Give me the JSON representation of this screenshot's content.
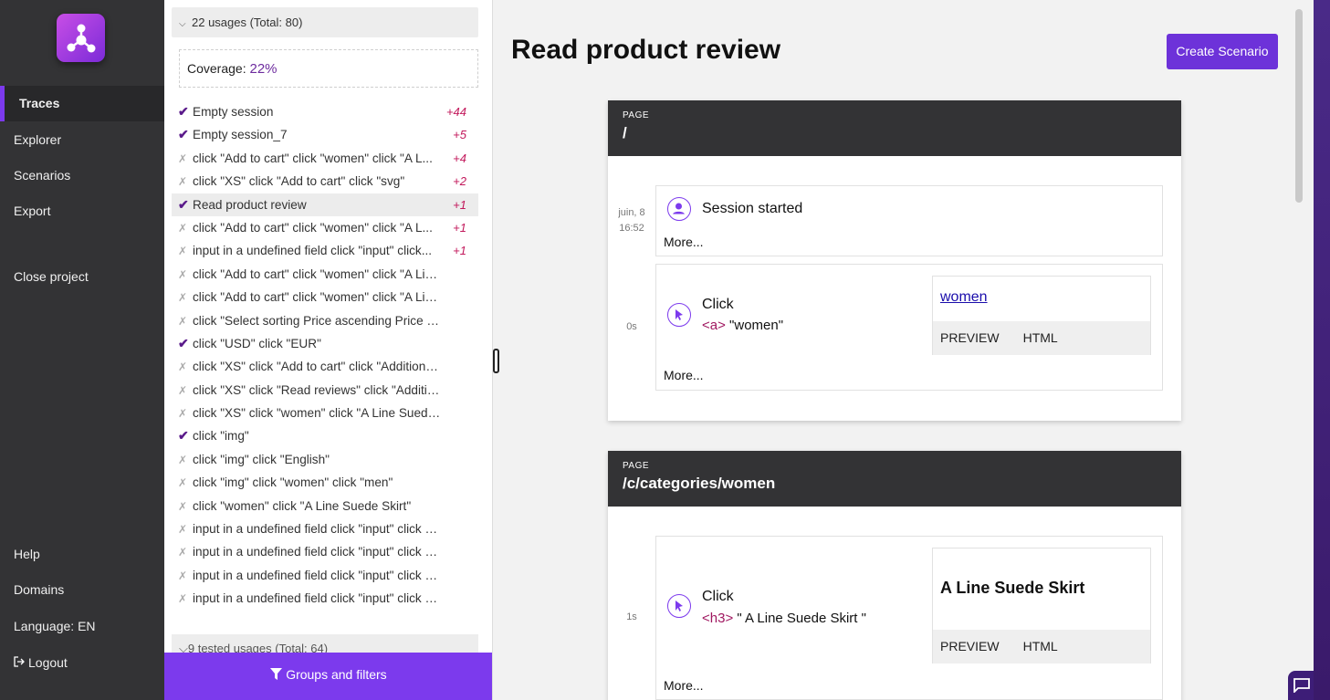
{
  "nav": {
    "items": [
      {
        "label": "Traces",
        "active": true
      },
      {
        "label": "Explorer"
      },
      {
        "label": "Scenarios"
      },
      {
        "label": "Export"
      },
      {
        "label": "Close project"
      },
      {
        "label": "Help"
      },
      {
        "label": "Domains"
      },
      {
        "label": "Language: EN"
      },
      {
        "label": "Logout"
      }
    ]
  },
  "panel": {
    "group_header": "22 usages (Total: 80)",
    "coverage_label": "Coverage:",
    "coverage_value": "22%",
    "rows": [
      {
        "text": "Empty session",
        "tested": true,
        "count": "+44"
      },
      {
        "text": "Empty session_7",
        "tested": true,
        "count": "+5"
      },
      {
        "text": "click \"Add to cart\" click \"women\" click \"A L...",
        "tested": false,
        "count": "+4"
      },
      {
        "text": "click \"XS\" click \"Add to cart\" click \"svg\"",
        "tested": false,
        "count": "+2"
      },
      {
        "text": "Read product review",
        "tested": true,
        "count": "+1",
        "selected": true
      },
      {
        "text": "click \"Add to cart\" click \"women\" click \"A L...",
        "tested": false,
        "count": "+1"
      },
      {
        "text": "input in a undefined field click \"input\" click...",
        "tested": false,
        "count": "+1"
      },
      {
        "text": "click \"Add to cart\" click \"women\" click \"A Line S...",
        "tested": false,
        "count": ""
      },
      {
        "text": "click \"Add to cart\" click \"women\" click \"A Line S...",
        "tested": false,
        "count": ""
      },
      {
        "text": "click \"Select sorting Price ascending Price des...",
        "tested": false,
        "count": ""
      },
      {
        "text": "click \"USD\" click \"EUR\"",
        "tested": true,
        "count": ""
      },
      {
        "text": "click \"XS\" click \"Add to cart\" click \"Additional In...",
        "tested": false,
        "count": ""
      },
      {
        "text": "click \"XS\" click \"Read reviews\" click \"Additional ...",
        "tested": false,
        "count": ""
      },
      {
        "text": "click \"XS\" click \"women\" click \"A Line Suede Ski...",
        "tested": false,
        "count": ""
      },
      {
        "text": "click \"img\"",
        "tested": true,
        "count": ""
      },
      {
        "text": "click \"img\" click \"English\"",
        "tested": false,
        "count": ""
      },
      {
        "text": "click \"img\" click \"women\" click \"men\"",
        "tested": false,
        "count": ""
      },
      {
        "text": "click \"women\" click \"A Line Suede Skirt\"",
        "tested": false,
        "count": ""
      },
      {
        "text": "input in a undefined field click \"input\" click \"XS\"",
        "tested": false,
        "count": ""
      },
      {
        "text": "input in a undefined field click \"input\" click \"XS\"...",
        "tested": false,
        "count": ""
      },
      {
        "text": "input in a undefined field click \"input\" click \"img\"",
        "tested": false,
        "count": ""
      },
      {
        "text": "input in a undefined field click \"input\" click \"img...",
        "tested": false,
        "count": ""
      }
    ],
    "group_header_2": "9 tested usages (Total: 64)",
    "filters_button": "Groups and filters"
  },
  "main": {
    "title": "Read product review",
    "create_button": "Create Scenario",
    "pages": [
      {
        "label": "PAGE",
        "path": "/",
        "events": [
          {
            "time": "juin, 8\n16:52",
            "title": "Session started",
            "more": "More..."
          },
          {
            "time": "0s",
            "title": "Click",
            "tag": "<a>",
            "target": " \"women\"",
            "preview_link": "women",
            "more": "More...",
            "tab_preview": "PREVIEW",
            "tab_html": "HTML"
          }
        ]
      },
      {
        "label": "PAGE",
        "path": "/c/categories/women",
        "events": [
          {
            "time": "1s",
            "title": "Click",
            "tag": "<h3>",
            "target": " \" A Line Suede Skirt \"",
            "preview_heading": "A Line Suede Skirt",
            "more": "More...",
            "tab_preview": "PREVIEW",
            "tab_html": "HTML"
          }
        ]
      }
    ]
  },
  "colors": {
    "accent": "#7c3aed",
    "nav_bg": "#333335",
    "tag": "#a01760",
    "count": "#c2185b"
  }
}
